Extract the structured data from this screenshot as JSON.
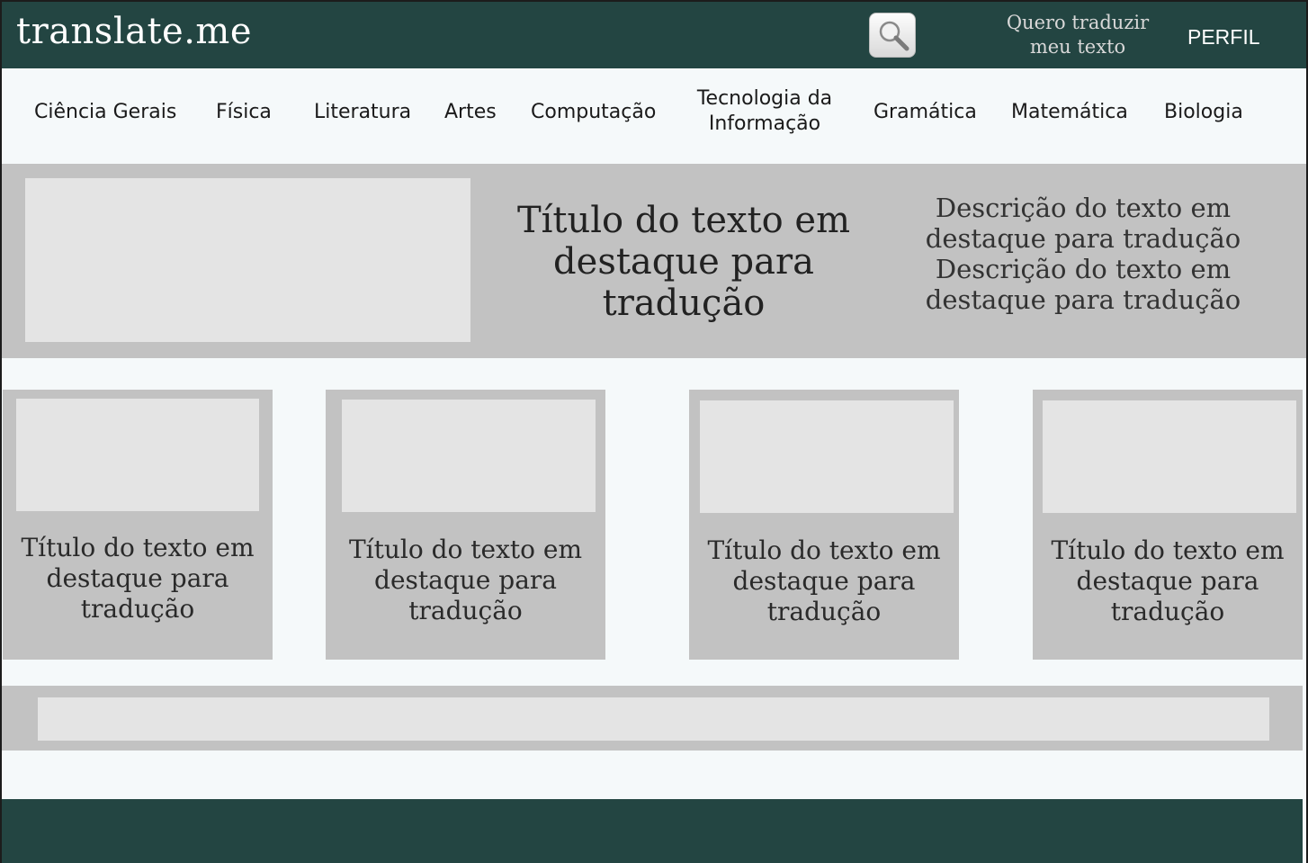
{
  "header": {
    "logo": "translate.me",
    "search_icon": "search-icon",
    "translate_link": "Quero traduzir meu texto",
    "profile": "PERFIL"
  },
  "categories": [
    "Ciência  Gerais",
    "Física",
    "Literatura",
    "Artes",
    "Computação",
    "Tecnologia da Informação",
    "Gramática",
    "Matemática",
    "Biologia"
  ],
  "featured": {
    "title": "Título do texto em destaque para tradução",
    "description": "Descrição do texto em destaque para tradução Descrição do texto em destaque para tradução"
  },
  "cards": [
    {
      "title": "Título do texto em destaque para tradução"
    },
    {
      "title": "Título do texto em destaque para tradução"
    },
    {
      "title": "Título do texto em destaque para tradução"
    },
    {
      "title": "Título do texto em destaque para tradução"
    }
  ],
  "colors": {
    "header_bg": "#234542",
    "page_bg": "#f5f9fa",
    "panel_gray": "#c2c2c2",
    "placeholder_gray": "#e4e4e4"
  }
}
